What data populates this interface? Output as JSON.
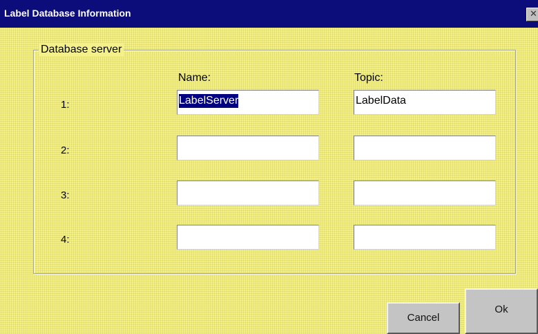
{
  "window": {
    "title": "Label Database Information",
    "close_symbol": "✕"
  },
  "group": {
    "legend": "Database server",
    "columns": {
      "name": "Name:",
      "topic": "Topic:"
    },
    "rows": [
      {
        "label": "1:",
        "name_value": "LabelServer",
        "topic_value": "LabelData"
      },
      {
        "label": "2:",
        "name_value": "",
        "topic_value": ""
      },
      {
        "label": "3:",
        "name_value": "",
        "topic_value": ""
      },
      {
        "label": "4:",
        "name_value": "",
        "topic_value": ""
      }
    ]
  },
  "buttons": {
    "cancel": "Cancel",
    "ok": "Ok"
  },
  "colors": {
    "title_bar": "#0c0c7a",
    "dialog_background": "#f4f08c",
    "selection": "#000080",
    "button_face": "#c4c4c4"
  },
  "icons": {
    "close": "close-icon"
  }
}
